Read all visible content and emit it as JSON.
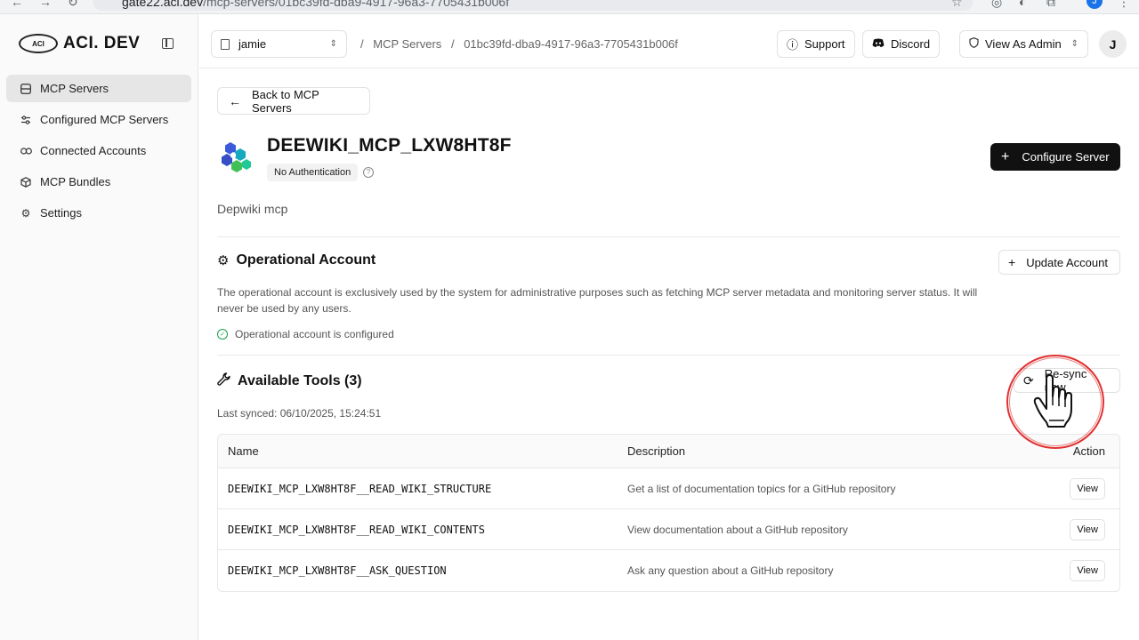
{
  "browser": {
    "url_host": "gate22.aci.dev",
    "url_path": "/mcp-servers/01bc39fd-dba9-4917-96a3-7705431b006f",
    "profile_initial": "J"
  },
  "sidebar": {
    "logo_badge": "ACI",
    "logo_text": "ACI. DEV",
    "items": [
      {
        "label": "MCP Servers",
        "icon": "server-icon",
        "active": true
      },
      {
        "label": "Configured MCP Servers",
        "icon": "sliders-icon",
        "active": false
      },
      {
        "label": "Connected Accounts",
        "icon": "link-icon",
        "active": false
      },
      {
        "label": "MCP Bundles",
        "icon": "package-icon",
        "active": false
      },
      {
        "label": "Settings",
        "icon": "gear-icon",
        "active": false
      }
    ]
  },
  "header": {
    "org": "jamie",
    "breadcrumb": [
      "MCP Servers",
      "01bc39fd-dba9-4917-96a3-7705431b006f"
    ],
    "support_label": "Support",
    "discord_label": "Discord",
    "view_as_label": "View As Admin",
    "avatar_initial": "J"
  },
  "main": {
    "back_label": "Back to MCP Servers",
    "server_name": "DEEWIKI_MCP_LXW8HT8F",
    "auth_badge": "No Authentication",
    "configure_label": "Configure Server",
    "description": "Depwiki mcp",
    "operational": {
      "title": "Operational Account",
      "update_label": "Update Account",
      "text": "The operational account is exclusively used by the system for administrative purposes such as fetching MCP server metadata and monitoring server status. It will never be used by any users.",
      "status": "Operational account is configured"
    },
    "tools": {
      "title": "Available Tools (3)",
      "resync_label": "Re-sync now",
      "last_synced": "Last synced: 06/10/2025, 15:24:51",
      "columns": [
        "Name",
        "Description",
        "Action"
      ],
      "rows": [
        {
          "name": "DEEWIKI_MCP_LXW8HT8F__READ_WIKI_STRUCTURE",
          "description": "Get a list of documentation topics for a GitHub repository",
          "action": "View"
        },
        {
          "name": "DEEWIKI_MCP_LXW8HT8F__READ_WIKI_CONTENTS",
          "description": "View documentation about a GitHub repository",
          "action": "View"
        },
        {
          "name": "DEEWIKI_MCP_LXW8HT8F__ASK_QUESTION",
          "description": "Ask any question about a GitHub repository",
          "action": "View"
        }
      ]
    }
  },
  "colors": {
    "primary_button": "#111111",
    "active_nav_bg": "#e6e6e6",
    "success": "#16a34a",
    "click_ring": "#e03131"
  }
}
